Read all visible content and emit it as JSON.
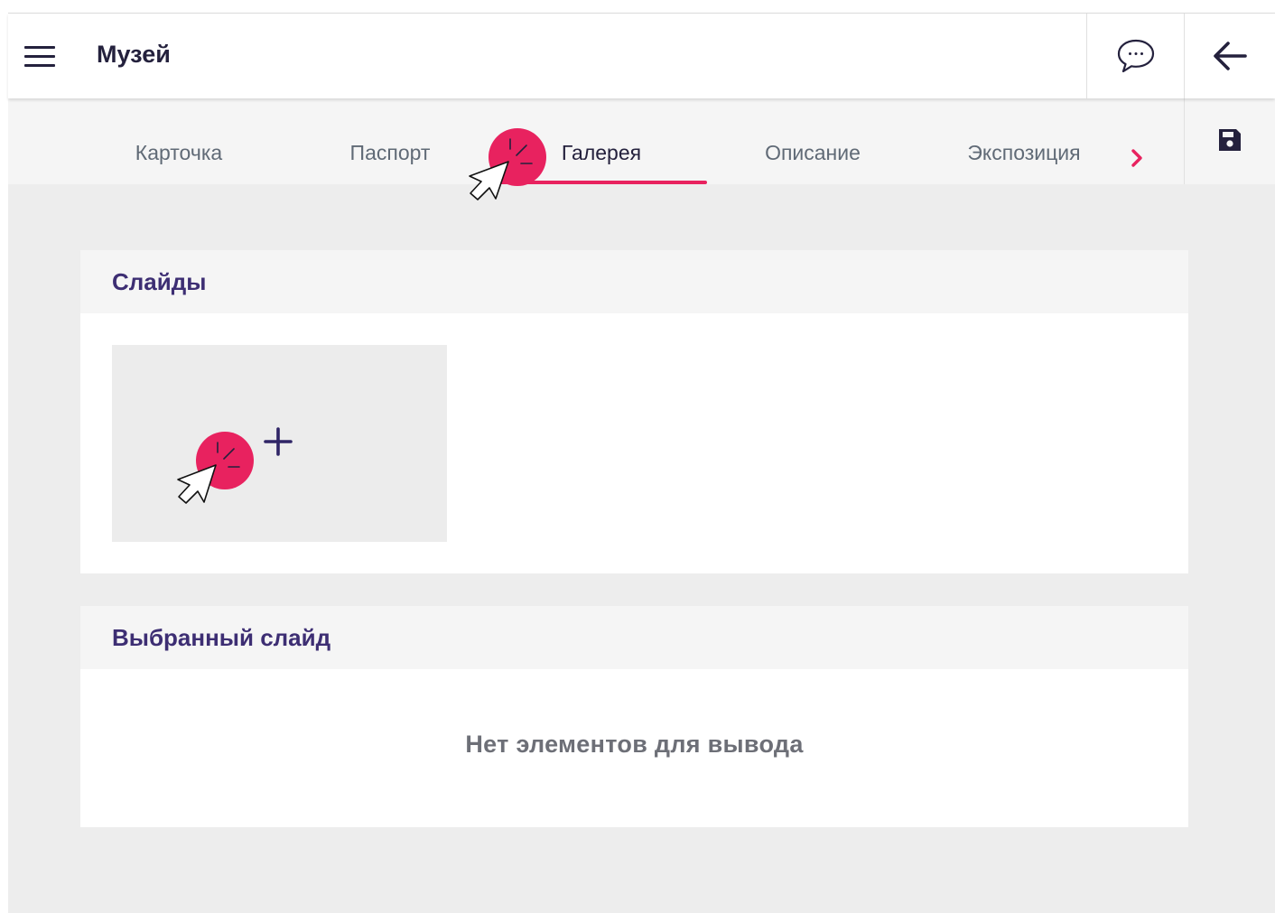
{
  "header": {
    "title": "Музей",
    "menu_icon": "hamburger-menu-icon",
    "chat_icon": "speech-bubble-icon",
    "back_icon": "arrow-left-icon"
  },
  "tabs": [
    {
      "label": "Карточка",
      "active": false
    },
    {
      "label": "Паспорт",
      "active": false
    },
    {
      "label": "Галерея",
      "active": true
    },
    {
      "label": "Описание",
      "active": false
    },
    {
      "label": "Экспозиция",
      "active": false
    }
  ],
  "tabs_next_icon": "chevron-right-icon",
  "save_icon": "floppy-disk-icon",
  "slides_panel": {
    "title": "Слайды",
    "add_icon": "plus-icon"
  },
  "selected_panel": {
    "title": "Выбранный слайд",
    "empty_text": "Нет элементов для вывода"
  },
  "colors": {
    "accent": "#e8225f",
    "heading": "#3d2e73",
    "dark": "#24213d",
    "tab_text": "#606a76",
    "background": "#ededed",
    "panel_header": "#f5f5f5"
  }
}
